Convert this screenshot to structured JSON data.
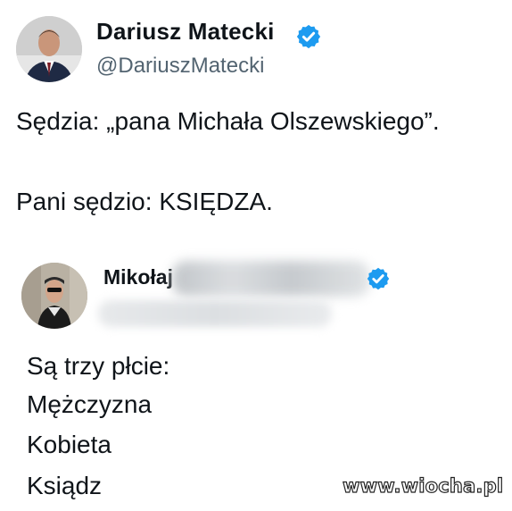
{
  "tweet": {
    "author_name": "Dariusz Matecki",
    "author_handle": "@DariuszMatecki",
    "verified_color": "#1d9bf0",
    "text_line1": "Sędzia: „pana Michała Olszewskiego”.",
    "text_line2": "Pani sędzio: KSIĘDZA."
  },
  "quoted_tweet": {
    "author_name_visible": "Mikołaj",
    "author_name_blurred": true,
    "handle_blurred": true,
    "lines": [
      "Są trzy płcie:",
      "Mężczyzna",
      "Kobieta",
      "Ksiądz"
    ]
  },
  "watermark": "www.wiocha.pl",
  "icons": {
    "verified": "verified-badge-icon"
  }
}
